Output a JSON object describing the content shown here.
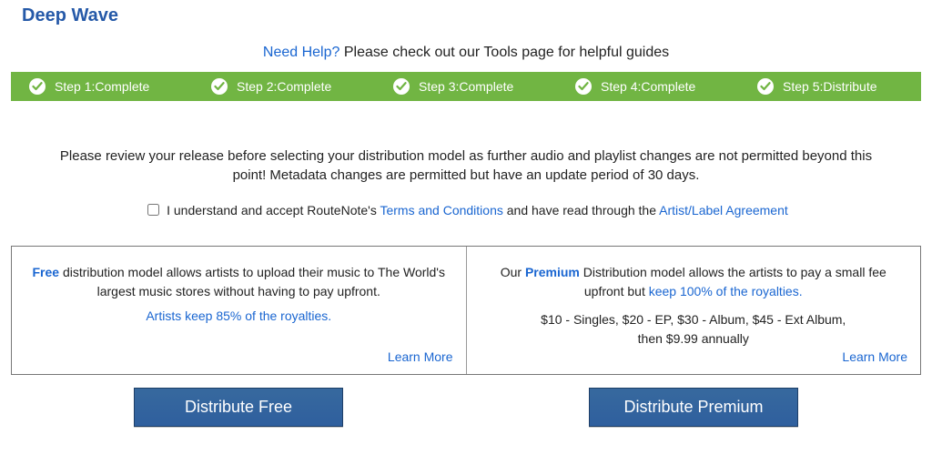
{
  "title": "Deep Wave",
  "help": {
    "link_text": "Need Help?",
    "tail_text": " Please check out our Tools page for helpful guides"
  },
  "steps": [
    {
      "label": "Step 1:Complete"
    },
    {
      "label": "Step 2:Complete"
    },
    {
      "label": "Step 3:Complete"
    },
    {
      "label": "Step 4:Complete"
    },
    {
      "label": "Step 5:Distribute"
    }
  ],
  "instructions": "Please review your release before selecting your distribution model as further audio and playlist changes are not permitted beyond this point! Metadata changes are permitted but have an update period of 30 days.",
  "consent": {
    "prefix": "I understand and accept RouteNote's ",
    "terms_link": "Terms and Conditions",
    "mid": " and have read through the ",
    "agreement_link": "Artist/Label Agreement"
  },
  "models": {
    "free": {
      "accent": "Free",
      "body": " distribution model allows artists to upload their music to The World's largest music stores without having to pay upfront.",
      "royalties": "Artists keep 85% of the royalties.",
      "learn_more": "Learn More",
      "cta": "Distribute Free"
    },
    "premium": {
      "lead": "Our ",
      "accent": "Premium",
      "body": " Distribution model allows the artists to pay a small fee upfront but ",
      "royalties_link": "keep 100% of the royalties.",
      "pricing_line1": "$10 - Singles, $20 - EP, $30 - Album, $45 - Ext Album,",
      "pricing_line2": "then $9.99 annually",
      "learn_more": "Learn More",
      "cta": "Distribute Premium"
    }
  }
}
